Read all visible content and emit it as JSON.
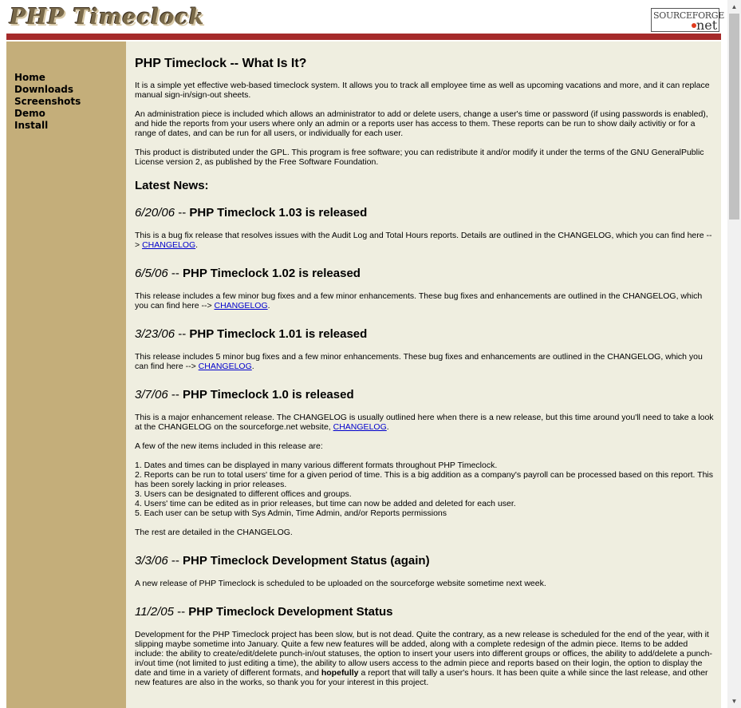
{
  "header": {
    "logo": "PHP Timeclock",
    "sf_top": "SOURCEFORGE",
    "sf_net": "net"
  },
  "nav": [
    "Home",
    "Downloads",
    "Screenshots",
    "Demo",
    "Install"
  ],
  "intro": {
    "title": "PHP Timeclock -- What Is It?",
    "paragraphs": [
      "It is a simple yet effective web-based timeclock system. It allows you to track all employee time as well as upcoming vacations and more, and it can replace manual sign-in/sign-out sheets.",
      "An administration piece is included which allows an administrator to add or delete users, change a user's time or password (if using passwords is enabled), and hide the reports from your users where only an admin or a reports user has access to them. These reports can be run to show daily activitiy or for a range of dates, and can be run for all users, or individually for each user.",
      "This product is distributed under the GPL. This program is free software; you can redistribute it and/or modify it under the terms of the GNU GeneralPublic License version 2, as published by the Free Software Foundation."
    ]
  },
  "latest_heading": "Latest News:",
  "news": [
    {
      "date": "6/20/06",
      "sep": " -- ",
      "title": "PHP Timeclock 1.03 is released",
      "body": "This is a bug fix release that resolves issues with the Audit Log and Total Hours reports. Details are outlined in the CHANGELOG, which you can find here --> ",
      "link": "CHANGELOG"
    },
    {
      "date": "6/5/06",
      "sep": " -- ",
      "title": "PHP Timeclock 1.02 is released",
      "body": "This release includes a few minor bug fixes and a few minor enhancements. These bug fixes and enhancements are outlined in the CHANGELOG, which you can find here --> ",
      "link": "CHANGELOG"
    },
    {
      "date": "3/23/06",
      "sep": " -- ",
      "title": "PHP Timeclock 1.01 is released",
      "body": "This release includes 5 minor bug fixes and a few minor enhancements. These bug fixes and enhancements are outlined in the CHANGELOG, which you can find here --> ",
      "link": "CHANGELOG"
    },
    {
      "date": "3/7/06",
      "sep": " -- ",
      "title": "PHP Timeclock 1.0 is released",
      "body": "This is a major enhancement release. The CHANGELOG is usually outlined here when there is a new release, but this time around you'll need to take a look at the CHANGELOG on the sourceforge.net website, ",
      "link": "CHANGELOG",
      "list_intro": "A few of the new items included in this release are:",
      "items": [
        "1. Dates and times can be displayed in many various different formats throughout PHP Timeclock.",
        "2. Reports can be run to total users' time for a given period of time. This is a big addition as a company's payroll can be processed based on this report. This has been sorely lacking in prior releases.",
        "3. Users can be designated to different offices and groups.",
        "4. Users' time can be edited as in prior releases, but time can now be added and deleted for each user.",
        "5. Each user can be setup with Sys Admin, Time Admin, and/or Reports permissions"
      ],
      "outro": "The rest are detailed in the CHANGELOG."
    },
    {
      "date": "3/3/06",
      "sep": " -- ",
      "title": "PHP Timeclock Development Status (again)",
      "body": "A new release of PHP Timeclock is scheduled to be uploaded on the sourceforge website sometime next week."
    },
    {
      "date": "11/2/05",
      "sep": " -- ",
      "title": "PHP Timeclock Development Status",
      "body_a": "Development for the PHP Timeclock project has been slow, but is not dead. Quite the contrary, as a new release is scheduled for the end of the year, with it slipping maybe sometime into January. Quite a few new features will be added, along with a complete redesign of the admin piece. Items to be added include: the ability to create/edit/delete punch-in/out statuses, the option to insert your users into different groups or offices, the ability to add/delete a punch-in/out time (not limited to just editing a time), the ability to allow users access to the admin piece and reports based on their login, the option to display the date and time in a variety of different formats, and ",
      "body_bold": "hopefully",
      "body_b": " a report that will tally a user's hours. It has been quite a while since the last release, and other new features are also in the works, so thank you for your interest in this project."
    }
  ]
}
